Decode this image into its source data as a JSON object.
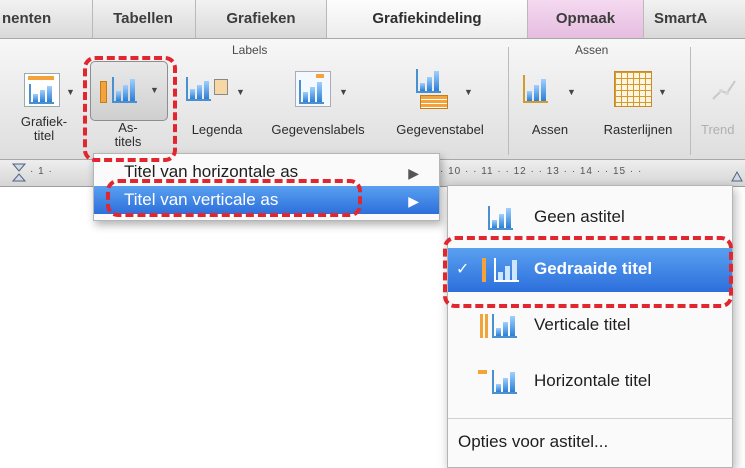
{
  "tabs": [
    {
      "label": "nenten"
    },
    {
      "label": "Tabellen"
    },
    {
      "label": "Grafieken"
    },
    {
      "label": "Grafiekindeling"
    },
    {
      "label": "Opmaak"
    },
    {
      "label": "SmartA"
    }
  ],
  "ribbon": {
    "groups": {
      "labels": "Labels",
      "assen": "Assen"
    },
    "buttons": {
      "grafiektitel": "Grafiek-\ntitel",
      "astitels": "As-\ntitels",
      "legenda": "Legenda",
      "gegevenslabels": "Gegevenslabels",
      "gegevenstabel": "Gegevenstabel",
      "assen": "Assen",
      "rasterlijnen": "Rasterlijnen",
      "trend": "Trend"
    }
  },
  "ruler": {
    "left": "· 1 ·",
    "right": "· 10 · · 11 · · 12 · · 13 · · 14 · · 15 · ·"
  },
  "menu_level1": {
    "items": [
      {
        "label": "Titel van horizontale as"
      },
      {
        "label": "Titel van verticale as"
      }
    ]
  },
  "menu_level2": {
    "items": [
      {
        "label": "Geen astitel"
      },
      {
        "label": "Gedraaide titel",
        "checked": true
      },
      {
        "label": "Verticale titel"
      },
      {
        "label": "Horizontale titel"
      }
    ],
    "options": "Opties voor astitel...",
    "checkmark": "✓"
  },
  "colors": {
    "highlight": "#2c6fdc",
    "annotation": "#e2262f",
    "opmaak_tab": "#e6bde0"
  }
}
